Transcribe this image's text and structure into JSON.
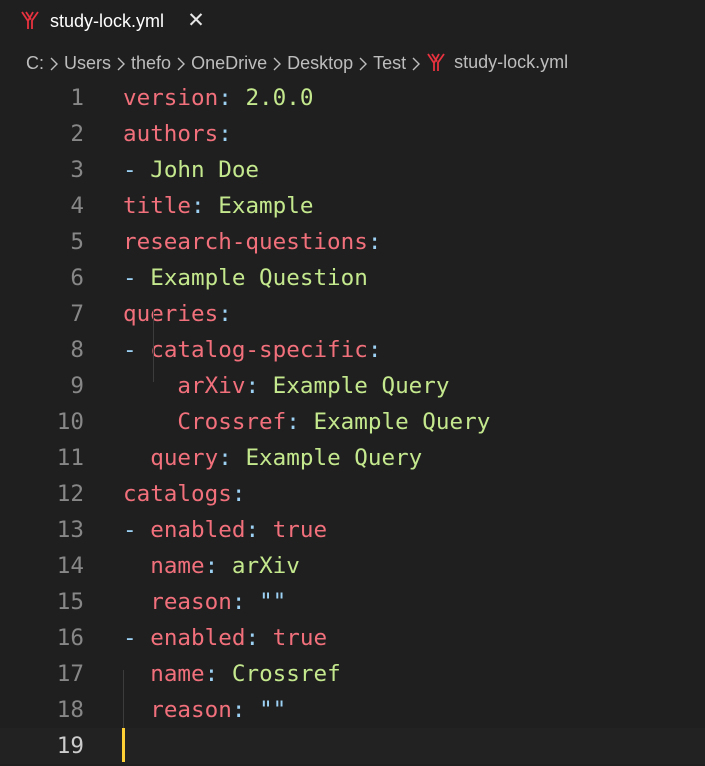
{
  "tab": {
    "label": "study-lock.yml",
    "close_glyph": "✕",
    "icon": "yaml-file-icon",
    "icon_color": "#e8323f"
  },
  "breadcrumb": {
    "items": [
      "C:",
      "Users",
      "thefo",
      "OneDrive",
      "Desktop",
      "Test",
      "study-lock.yml"
    ]
  },
  "editor": {
    "current_line": 19,
    "lines": [
      {
        "n": "1",
        "tokens": [
          {
            "t": "version",
            "c": "k"
          },
          {
            "t": ": ",
            "c": "p"
          },
          {
            "t": "2.0.0",
            "c": "s"
          }
        ]
      },
      {
        "n": "2",
        "tokens": [
          {
            "t": "authors",
            "c": "k"
          },
          {
            "t": ":",
            "c": "p"
          }
        ]
      },
      {
        "n": "3",
        "tokens": [
          {
            "t": "- ",
            "c": "p"
          },
          {
            "t": "John Doe",
            "c": "s"
          }
        ]
      },
      {
        "n": "4",
        "tokens": [
          {
            "t": "title",
            "c": "k"
          },
          {
            "t": ": ",
            "c": "p"
          },
          {
            "t": "Example",
            "c": "s"
          }
        ]
      },
      {
        "n": "5",
        "tokens": [
          {
            "t": "research-questions",
            "c": "k"
          },
          {
            "t": ":",
            "c": "p"
          }
        ]
      },
      {
        "n": "6",
        "tokens": [
          {
            "t": "- ",
            "c": "p"
          },
          {
            "t": "Example Question",
            "c": "s"
          }
        ]
      },
      {
        "n": "7",
        "tokens": [
          {
            "t": "queries",
            "c": "k"
          },
          {
            "t": ":",
            "c": "p"
          }
        ]
      },
      {
        "n": "8",
        "tokens": [
          {
            "t": "- ",
            "c": "p"
          },
          {
            "t": "catalog-specific",
            "c": "k"
          },
          {
            "t": ":",
            "c": "p"
          }
        ]
      },
      {
        "n": "9",
        "tokens": [
          {
            "t": "    ",
            "c": "p"
          },
          {
            "t": "arXiv",
            "c": "k"
          },
          {
            "t": ": ",
            "c": "p"
          },
          {
            "t": "Example Query",
            "c": "s"
          }
        ]
      },
      {
        "n": "10",
        "tokens": [
          {
            "t": "    ",
            "c": "p"
          },
          {
            "t": "Crossref",
            "c": "k"
          },
          {
            "t": ": ",
            "c": "p"
          },
          {
            "t": "Example Query",
            "c": "s"
          }
        ]
      },
      {
        "n": "11",
        "tokens": [
          {
            "t": "  ",
            "c": "p"
          },
          {
            "t": "query",
            "c": "k"
          },
          {
            "t": ": ",
            "c": "p"
          },
          {
            "t": "Example Query",
            "c": "s"
          }
        ]
      },
      {
        "n": "12",
        "tokens": [
          {
            "t": "catalogs",
            "c": "k"
          },
          {
            "t": ":",
            "c": "p"
          }
        ]
      },
      {
        "n": "13",
        "tokens": [
          {
            "t": "- ",
            "c": "p"
          },
          {
            "t": "enabled",
            "c": "k"
          },
          {
            "t": ": ",
            "c": "p"
          },
          {
            "t": "true",
            "c": "b"
          }
        ]
      },
      {
        "n": "14",
        "tokens": [
          {
            "t": "  ",
            "c": "p"
          },
          {
            "t": "name",
            "c": "k"
          },
          {
            "t": ": ",
            "c": "p"
          },
          {
            "t": "arXiv",
            "c": "s"
          }
        ]
      },
      {
        "n": "15",
        "tokens": [
          {
            "t": "  ",
            "c": "p"
          },
          {
            "t": "reason",
            "c": "k"
          },
          {
            "t": ": ",
            "c": "p"
          },
          {
            "t": "\"\"",
            "c": "p"
          }
        ]
      },
      {
        "n": "16",
        "tokens": [
          {
            "t": "- ",
            "c": "p"
          },
          {
            "t": "enabled",
            "c": "k"
          },
          {
            "t": ": ",
            "c": "p"
          },
          {
            "t": "true",
            "c": "b"
          }
        ]
      },
      {
        "n": "17",
        "tokens": [
          {
            "t": "  ",
            "c": "p"
          },
          {
            "t": "name",
            "c": "k"
          },
          {
            "t": ": ",
            "c": "p"
          },
          {
            "t": "Crossref",
            "c": "s"
          }
        ]
      },
      {
        "n": "18",
        "tokens": [
          {
            "t": "  ",
            "c": "p"
          },
          {
            "t": "reason",
            "c": "k"
          },
          {
            "t": ": ",
            "c": "p"
          },
          {
            "t": "\"\"",
            "c": "p"
          }
        ]
      },
      {
        "n": "19",
        "tokens": []
      }
    ]
  },
  "colors": {
    "background": "#1f1f1f",
    "key": "#f1707b",
    "punctuation": "#9dd2f5",
    "string": "#c4e88d",
    "line_number": "#878787",
    "cursor": "#ffd035"
  }
}
